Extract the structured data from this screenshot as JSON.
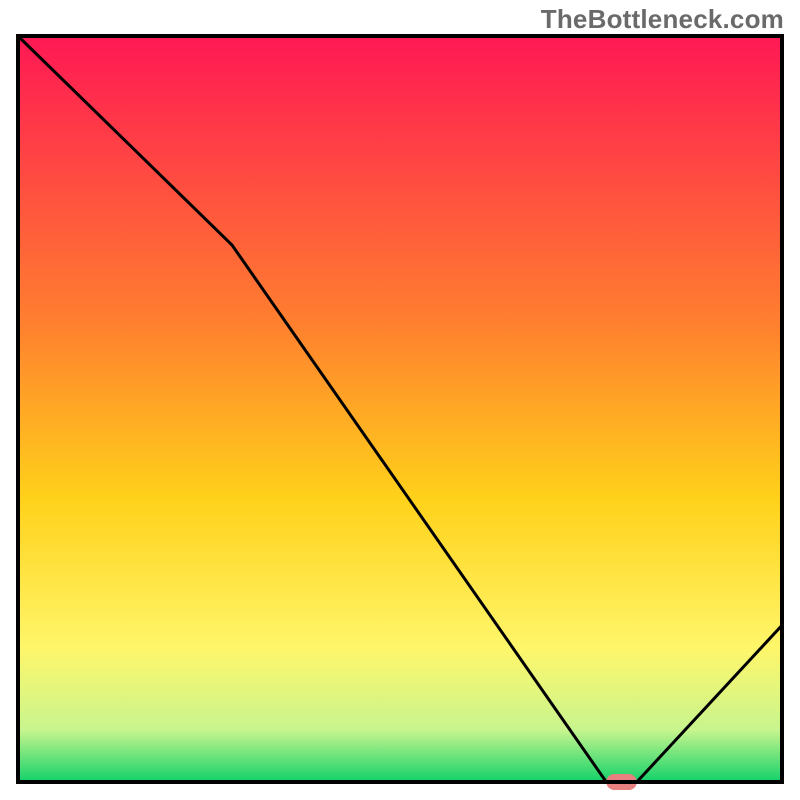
{
  "watermark": "TheBottleneck.com",
  "chart_data": {
    "type": "line",
    "title": "",
    "xlabel": "",
    "ylabel": "",
    "xlim": [
      0,
      100
    ],
    "ylim": [
      0,
      100
    ],
    "series": [
      {
        "name": "bottleneck-curve",
        "x": [
          0,
          28,
          77,
          81,
          100
        ],
        "y": [
          100,
          72,
          0,
          0,
          21
        ]
      }
    ],
    "marker": {
      "name": "optimal-range",
      "x_start": 77,
      "x_end": 81,
      "y": 0,
      "color": "#e8817f"
    },
    "background_gradient": {
      "stops": [
        {
          "pos": 0.0,
          "color": "#ff1854"
        },
        {
          "pos": 0.38,
          "color": "#ff7e2f"
        },
        {
          "pos": 0.62,
          "color": "#ffd11a"
        },
        {
          "pos": 0.82,
          "color": "#fff66a"
        },
        {
          "pos": 0.93,
          "color": "#c8f58e"
        },
        {
          "pos": 1.0,
          "color": "#12d169"
        }
      ]
    },
    "plot_frame": {
      "color": "#000000",
      "width": 4
    },
    "curve_style": {
      "color": "#000000",
      "width": 3
    }
  }
}
